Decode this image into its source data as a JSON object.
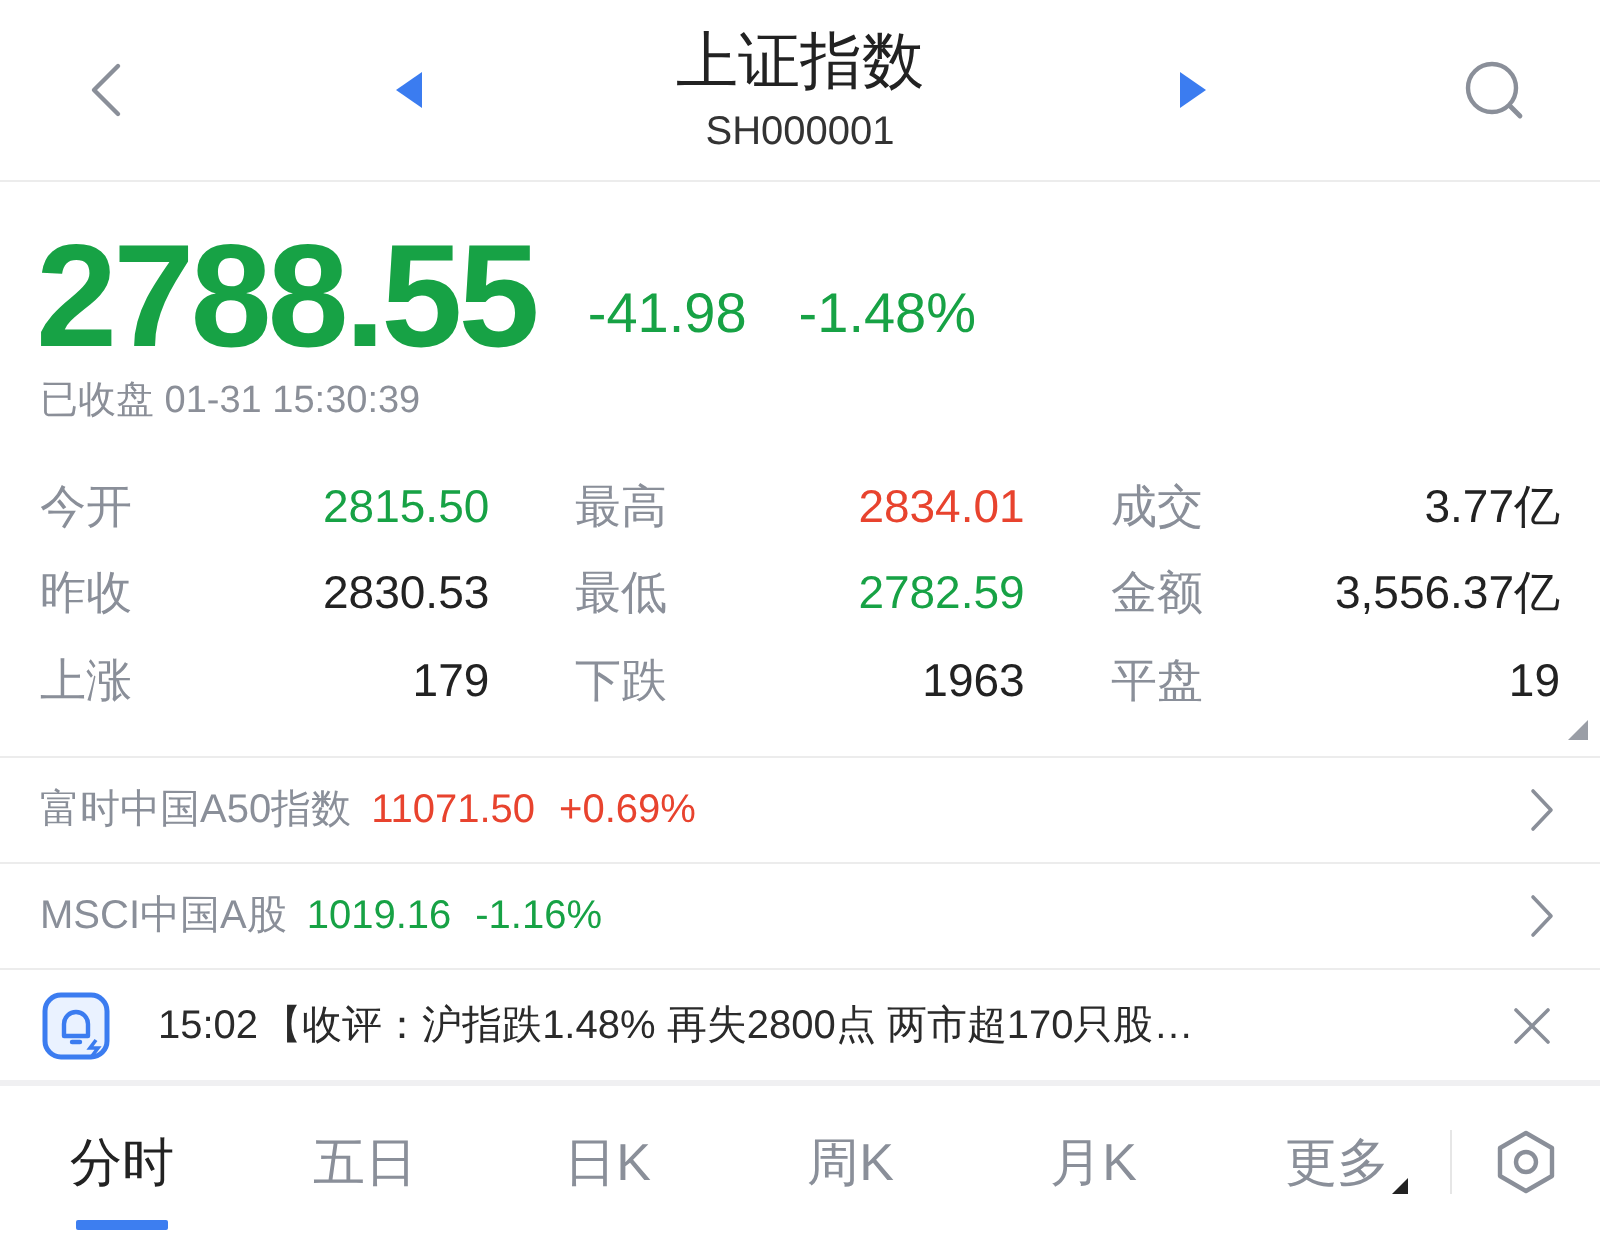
{
  "header": {
    "title": "上证指数",
    "code": "SH000001"
  },
  "quote": {
    "price": "2788.55",
    "change": "-41.98",
    "change_percent": "-1.48%",
    "color": "#17a245",
    "status": "已收盘 01-31 15:30:39"
  },
  "stats": [
    {
      "label": "今开",
      "value": "2815.50",
      "color": "#17a245"
    },
    {
      "label": "最高",
      "value": "2834.01",
      "color": "#e8432e"
    },
    {
      "label": "成交",
      "value": "3.77亿",
      "color": "#222222"
    },
    {
      "label": "昨收",
      "value": "2830.53",
      "color": "#222222"
    },
    {
      "label": "最低",
      "value": "2782.59",
      "color": "#17a245"
    },
    {
      "label": "金额",
      "value": "3,556.37亿",
      "color": "#222222"
    },
    {
      "label": "上涨",
      "value": "179",
      "color": "#222222"
    },
    {
      "label": "下跌",
      "value": "1963",
      "color": "#222222"
    },
    {
      "label": "平盘",
      "value": "19",
      "color": "#222222"
    }
  ],
  "related": [
    {
      "name": "富时中国A50指数",
      "value": "11071.50",
      "change": "+0.69%",
      "color": "#e8432e"
    },
    {
      "name": "MSCI中国A股",
      "value": "1019.16",
      "change": "-1.16%",
      "color": "#17a245"
    }
  ],
  "news": {
    "time": "15:02",
    "text": "【收评：沪指跌1.48% 再失2800点 两市超170只股…"
  },
  "tabs": [
    {
      "label": "分时",
      "selected": true,
      "kind": "plain"
    },
    {
      "label": "五日",
      "selected": false,
      "kind": "plain"
    },
    {
      "label": "日K",
      "selected": false,
      "kind": "plain"
    },
    {
      "label": "周K",
      "selected": false,
      "kind": "plain"
    },
    {
      "label": "月K",
      "selected": false,
      "kind": "plain"
    },
    {
      "label": "更多",
      "selected": false,
      "kind": "dropdown"
    }
  ]
}
